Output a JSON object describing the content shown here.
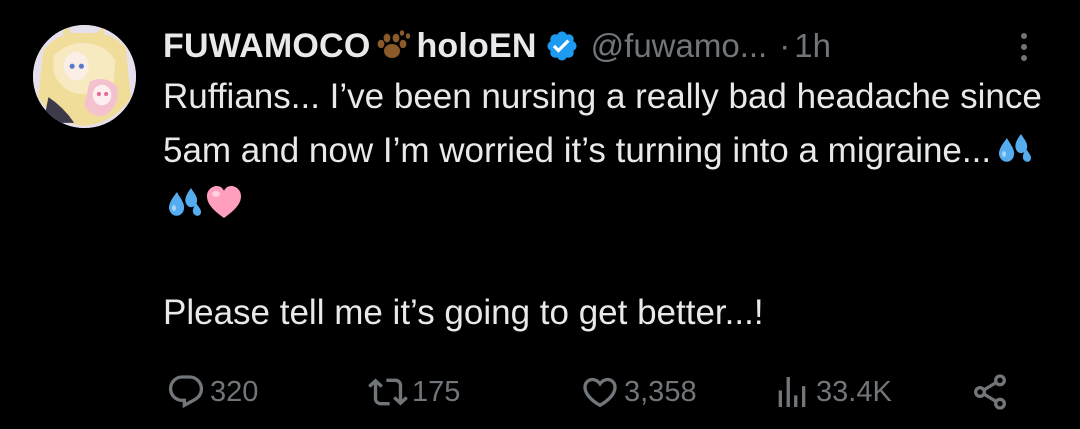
{
  "tweet": {
    "display_name": "FUWAMOCO",
    "display_name_suffix": "holoEN",
    "handle": "@fuwamo...",
    "separator": "·",
    "time": "1h",
    "body_line1": "Ruffians... I’ve been nursing a really bad headache since 5am and now I’m worried it’s turning into a migraine...",
    "body_line2": "Please tell me it’s going to get better...!",
    "emojis": [
      "sweat-droplets-emoji",
      "sweat-droplets-emoji",
      "pink-heart-emoji"
    ]
  },
  "actions": {
    "replies": "320",
    "reposts": "175",
    "likes": "3,358",
    "views": "33.4K"
  },
  "icons": {
    "verified": "verified-badge-icon",
    "paw": "paw-print-icon",
    "more": "more-options-icon",
    "reply": "reply-icon",
    "repost": "repost-icon",
    "like": "heart-icon",
    "views": "views-chart-icon",
    "share": "share-icon"
  },
  "colors": {
    "background": "#000000",
    "text_primary": "#e7e9ea",
    "text_secondary": "#71767b",
    "verified_blue": "#1d9bf0"
  }
}
